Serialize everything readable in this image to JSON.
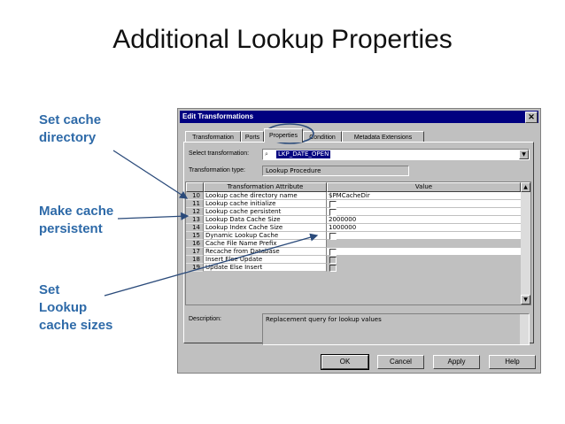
{
  "slide": {
    "title": "Additional Lookup Properties",
    "callouts": [
      {
        "text": "Set cache\ndirectory"
      },
      {
        "text": "Make cache\npersistent"
      },
      {
        "text": "Set\nLookup\ncache sizes"
      }
    ],
    "accent_color": "#2e6aa8"
  },
  "dialog": {
    "title": "Edit Transformations",
    "close_icon": "close-icon",
    "tabs": [
      "Transformation",
      "Ports",
      "Properties",
      "Condition",
      "Metadata Extensions"
    ],
    "active_tab": "Properties",
    "select_label": "Select transformation:",
    "select_value": "LKP_DATE_OPEN",
    "type_label": "Transformation type:",
    "type_value": "Lookup Procedure",
    "table": {
      "headers": [
        "Transformation Attribute",
        "Value"
      ],
      "rows": [
        {
          "num": "10",
          "attr": "Lookup cache directory name",
          "value": "$PMCacheDir"
        },
        {
          "num": "11",
          "attr": "Lookup cache initialize",
          "value": ""
        },
        {
          "num": "12",
          "attr": "Lookup cache persistent",
          "value": ""
        },
        {
          "num": "13",
          "attr": "Lookup Data Cache Size",
          "value": "2000000"
        },
        {
          "num": "14",
          "attr": "Lookup Index Cache Size",
          "value": "1000000"
        },
        {
          "num": "15",
          "attr": "Dynamic Lookup Cache",
          "value": ""
        },
        {
          "num": "16",
          "attr": "Cache File Name Prefix",
          "value": ""
        },
        {
          "num": "17",
          "attr": "Recache from Database",
          "value": ""
        },
        {
          "num": "18",
          "attr": "Insert Else Update",
          "value": ""
        },
        {
          "num": "19",
          "attr": "Update Else Insert",
          "value": ""
        }
      ]
    },
    "description_label": "Description:",
    "description_value": "Replacement query for lookup values",
    "buttons": {
      "ok": "OK",
      "cancel": "Cancel",
      "apply": "Apply",
      "help": "Help"
    },
    "titlebar_color": "#000080"
  }
}
